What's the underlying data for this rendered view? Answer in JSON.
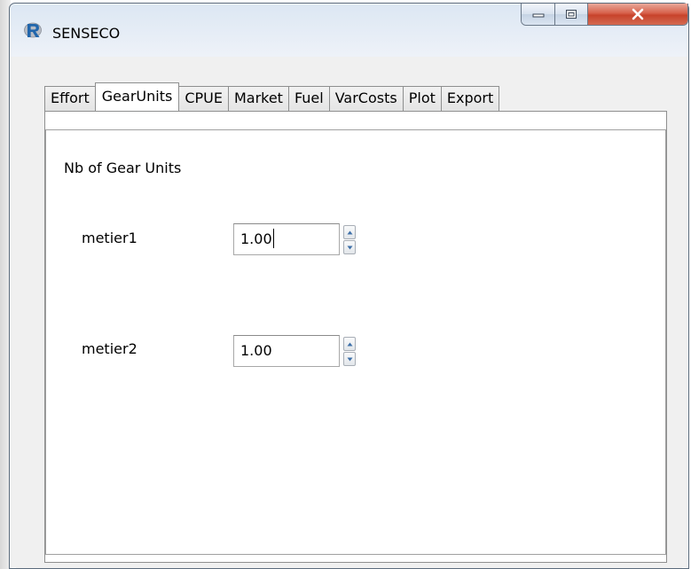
{
  "window": {
    "title": "SENSECO",
    "app_icon": "r-logo-icon",
    "controls": [
      "minimize-icon",
      "maximize-icon",
      "close-icon"
    ]
  },
  "tabs": [
    {
      "label": "Effort",
      "active": false
    },
    {
      "label": "GearUnits",
      "active": true
    },
    {
      "label": "CPUE",
      "active": false
    },
    {
      "label": "Market",
      "active": false
    },
    {
      "label": "Fuel",
      "active": false
    },
    {
      "label": "VarCosts",
      "active": false
    },
    {
      "label": "Plot",
      "active": false
    },
    {
      "label": "Export",
      "active": false
    }
  ],
  "panel": {
    "section_label": "Nb of Gear Units",
    "rows": [
      {
        "label": "metier1",
        "value": "1.00",
        "focused": true
      },
      {
        "label": "metier2",
        "value": "1.00",
        "focused": false
      }
    ]
  },
  "colors": {
    "title_bar": "#dce7f3",
    "close_button": "#c7432b",
    "r_logo": "#2166ac"
  }
}
